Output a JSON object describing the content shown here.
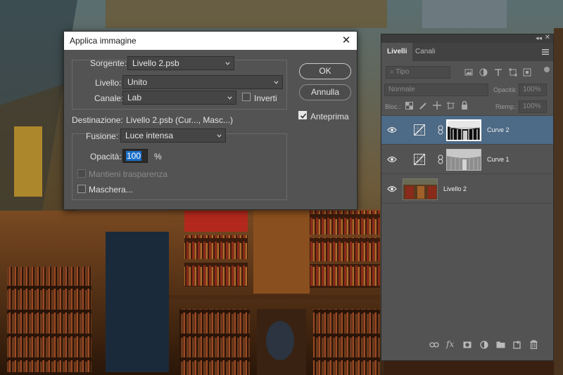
{
  "dialog": {
    "title": "Applica immagine",
    "source_label": "Sorgente:",
    "source_value": "Livello 2.psb",
    "layer_label": "Livello:",
    "layer_value": "Unito",
    "channel_label": "Canale:",
    "channel_value": "Lab",
    "invert_label": "Inverti",
    "invert_checked": false,
    "destination_label": "Destinazione:",
    "destination_value": "Livello 2.psb (Cur..., Masc...)",
    "blending_label": "Fusione:",
    "blending_value": "Luce intensa",
    "opacity_label": "Opacità:",
    "opacity_value": "100",
    "opacity_unit": "%",
    "preserve_transparency_label": "Mantieni trasparenza",
    "mask_label": "Maschera...",
    "ok_label": "OK",
    "cancel_label": "Annulla",
    "preview_label": "Anteprima",
    "preview_checked": true
  },
  "layers_panel": {
    "tabs": [
      "Livelli",
      "Canali"
    ],
    "active_tab": "Livelli",
    "filter_placeholder": "Tipo",
    "blend_mode": "Normale",
    "opacity_label": "Opacità:",
    "opacity_value": "100%",
    "lock_label": "Bloc.:",
    "fill_label": "Riemp.:",
    "fill_value": "100%",
    "layers": [
      {
        "name": "Curve 2",
        "selected": true,
        "type": "curves-adjustment"
      },
      {
        "name": "Curve 1",
        "selected": false,
        "type": "curves-adjustment"
      },
      {
        "name": "Livello 2",
        "selected": false,
        "type": "image"
      }
    ],
    "bottom_icons": [
      "link-icon",
      "fx-icon",
      "mask-icon",
      "adjustment-icon",
      "folder-icon",
      "new-layer-icon",
      "trash-icon"
    ]
  },
  "colors": {
    "dialog_bg": "#535353",
    "panel_bg": "#535353",
    "selection": "#4d6a86",
    "highlight": "#1c6fc9"
  }
}
